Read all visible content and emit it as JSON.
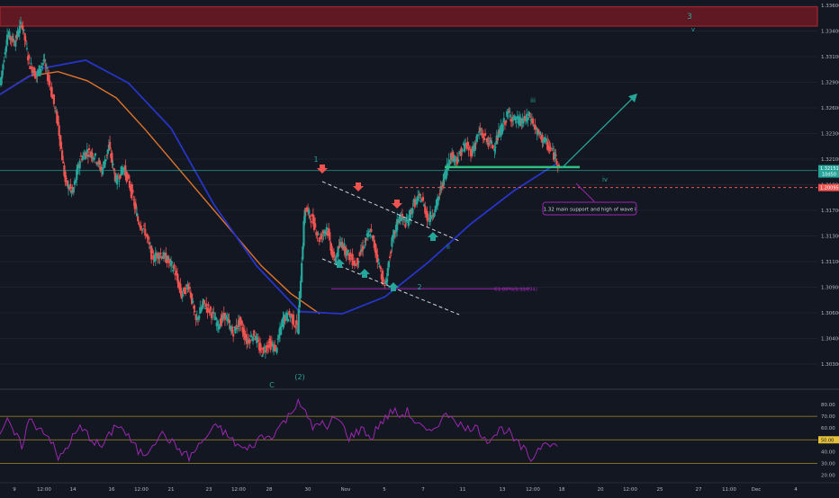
{
  "theme": {
    "background": "#131722",
    "grid": "#1e2230",
    "axis_text": "#b2b5be",
    "up_candle": "#26a69a",
    "down_candle": "#ef5350",
    "resistance_zone": "#6e1a22",
    "resistance_border": "#b22833",
    "ema_slow": "#e0742a",
    "ema_fast": "#2634c8",
    "wave_label": "#26a69a",
    "support_line": "#2ec27e",
    "current_price_line": "#26a69a",
    "dashed_channel": "#d1d4dc",
    "projection_arrow": "#26a69a",
    "fib_line": "#9c27b0",
    "red_dashed": "#ef5350",
    "annotation_border": "#9c27b0",
    "rsi_line": "#9c27b0",
    "rsi_level_lines": "#c8a92a"
  },
  "price_axis": {
    "labels": [
      "1.33600",
      "1.33400",
      "1.33100",
      "1.32900",
      "1.32600",
      "1.32300",
      "1.32100",
      "1.31800",
      "1.31700",
      "1.31300",
      "1.31100",
      "1.30900",
      "1.30600",
      "1.30400",
      "1.30300"
    ],
    "current_price_tag": "1.32151",
    "current_price_subtag": "10d50",
    "red_level_tag": "1.20095"
  },
  "rsi_axis": {
    "labels": [
      "80.00",
      "70.00",
      "60.00",
      "50.00",
      "40.00",
      "30.00",
      "20.00"
    ],
    "current_tag": "50.00"
  },
  "time_axis": {
    "labels": [
      "9",
      "12:00",
      "14",
      "16",
      "12:00",
      "21",
      "23",
      "12:00",
      "28",
      "30",
      "Nov",
      "5",
      "7",
      "11",
      "13",
      "12:00",
      "18",
      "20",
      "12:00",
      "25",
      "27",
      "11:00",
      "Dec",
      "4"
    ]
  },
  "annotations": {
    "top_wave_3": "3",
    "top_wave_v": "v",
    "wave_1": "1",
    "wave_2": "2",
    "wave_C": "C",
    "wave_paren_2": "(2)",
    "wave_ii": "ii",
    "wave_iii": "iii",
    "wave_iv": "iv",
    "fib_label": "61.80%(1.11094)",
    "callout": "1.32 main support and high of wave i"
  },
  "chart_data": [
    {
      "type": "candlestick",
      "title": "",
      "ylim": [
        1.3025,
        1.3365
      ],
      "series": [
        {
          "name": "",
          "kind": "price",
          "close_path": [
            1.329,
            1.3335,
            1.3328,
            1.3345,
            1.331,
            1.3298,
            1.3312,
            1.3287,
            1.3255,
            1.3205,
            1.3195,
            1.3225,
            1.3232,
            1.3228,
            1.3215,
            1.3236,
            1.3205,
            1.3218,
            1.3199,
            1.3171,
            1.3161,
            1.3138,
            1.3142,
            1.3137,
            1.3128,
            1.3105,
            1.3115,
            1.3082,
            1.3098,
            1.3091,
            1.3079,
            1.3088,
            1.3072,
            1.3082,
            1.3065,
            1.3071,
            1.3055,
            1.3063,
            1.3058,
            1.3085,
            1.3088,
            1.3075,
            1.3182,
            1.3172,
            1.3155,
            1.3165,
            1.3135,
            1.3152,
            1.3141,
            1.3132,
            1.3148,
            1.3162,
            1.3138,
            1.3112,
            1.3152,
            1.3175,
            1.3168,
            1.3186,
            1.3192,
            1.3172,
            1.3182,
            1.3205,
            1.3228,
            1.3225,
            1.3238,
            1.3231,
            1.3249,
            1.3242,
            1.3236,
            1.3251,
            1.3265,
            1.3259,
            1.3258,
            1.3263,
            1.3248,
            1.3241,
            1.3232,
            1.3221
          ]
        },
        {
          "name": "",
          "kind": "ema_slow",
          "points": [
            1.3282,
            1.3298,
            1.3302,
            1.3294,
            1.3279,
            1.3251,
            1.3221,
            1.3191,
            1.3161,
            1.3131,
            1.3107,
            1.3089
          ]
        },
        {
          "name": "",
          "kind": "ema_fast",
          "points": [
            1.3282,
            1.3305,
            1.3312,
            1.3292,
            1.3252,
            1.3185,
            1.3131,
            1.3091,
            1.3089,
            1.3104,
            1.3134,
            1.3168,
            1.3197,
            1.3221
          ]
        }
      ],
      "levels": {
        "resistance_zone": [
          1.3342,
          1.3359
        ],
        "support": 1.3218,
        "current_price": 1.32151,
        "red_dashed": 1.32,
        "fib_618": 1.311094
      }
    },
    {
      "type": "line",
      "title": "",
      "ylim": [
        15,
        90
      ],
      "levels": [
        70,
        50,
        30
      ],
      "series": [
        {
          "name": "",
          "values": [
            56,
            65,
            55,
            45,
            67,
            62,
            58,
            50,
            33,
            42,
            52,
            60,
            55,
            48,
            44,
            53,
            64,
            58,
            49,
            40,
            38,
            47,
            55,
            52,
            45,
            40,
            35,
            42,
            50,
            57,
            62,
            55,
            49,
            44,
            41,
            47,
            53,
            52,
            58,
            65,
            72,
            85,
            72,
            60,
            66,
            58,
            70,
            63,
            52,
            56,
            60,
            50,
            62,
            68,
            75,
            70,
            74,
            66,
            60,
            55,
            63,
            69,
            72,
            65,
            58,
            62,
            57,
            50,
            54,
            60,
            56,
            47,
            42,
            33,
            42,
            50,
            47,
            42
          ]
        }
      ]
    }
  ]
}
